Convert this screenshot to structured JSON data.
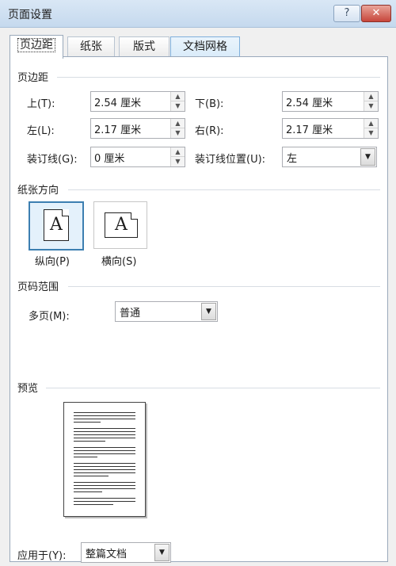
{
  "window": {
    "title": "页面设置",
    "help_glyph": "?",
    "close_glyph": "✕"
  },
  "tabs": [
    {
      "label": "页边距",
      "active": true
    },
    {
      "label": "纸张"
    },
    {
      "label": "版式"
    },
    {
      "label": "文档网格"
    }
  ],
  "margins": {
    "section_title": "页边距",
    "top_label": "上(T):",
    "top_value": "2.54 厘米",
    "bottom_label": "下(B):",
    "bottom_value": "2.54 厘米",
    "left_label": "左(L):",
    "left_value": "2.17 厘米",
    "right_label": "右(R):",
    "right_value": "2.17 厘米",
    "gutter_label": "装订线(G):",
    "gutter_value": "0 厘米",
    "gutter_pos_label": "装订线位置(U):",
    "gutter_pos_value": "左"
  },
  "orientation": {
    "section_title": "纸张方向",
    "portrait_label": "纵向(P)",
    "landscape_label": "横向(S)",
    "icon_letter": "A",
    "selected": "portrait"
  },
  "pages": {
    "section_title": "页码范围",
    "multiple_label": "多页(M):",
    "multiple_value": "普通"
  },
  "preview": {
    "section_title": "预览"
  },
  "apply": {
    "label": "应用于(Y):",
    "value": "整篇文档"
  },
  "icons": {
    "spin_up": "▲",
    "spin_down": "▼",
    "dropdown": "▼"
  }
}
